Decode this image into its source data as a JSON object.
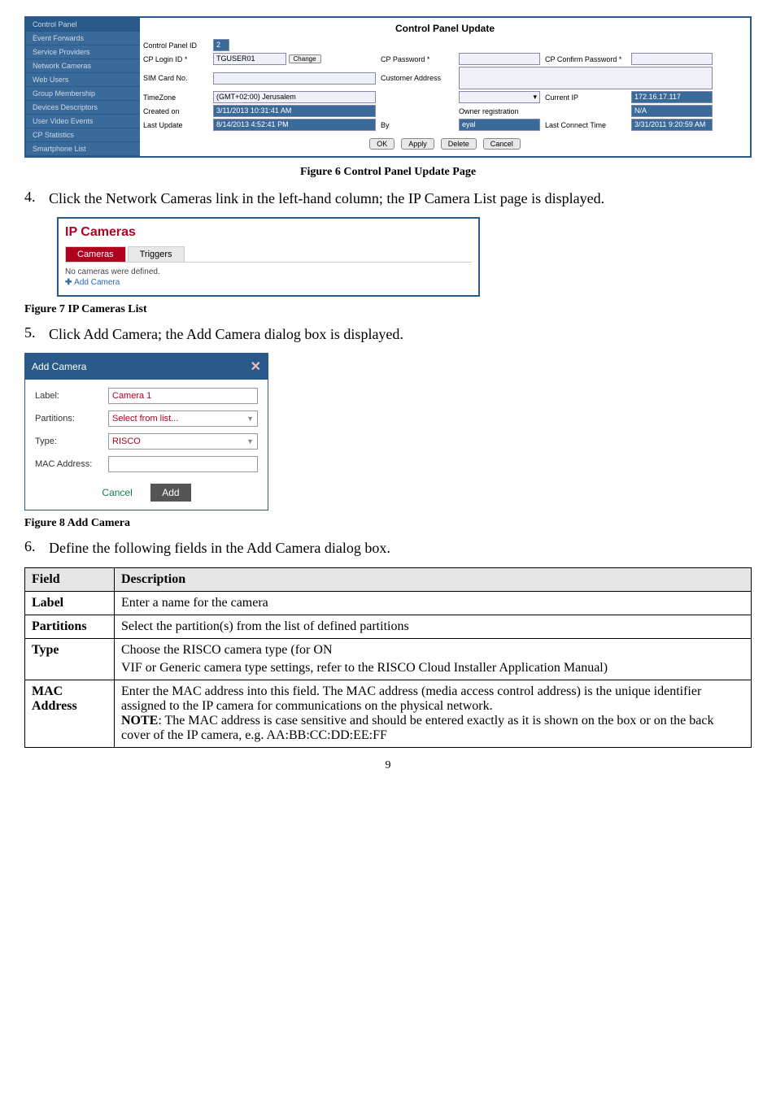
{
  "control_panel": {
    "sidebar": [
      "Control Panel",
      "Event Forwards",
      "Service Providers",
      "Network Cameras",
      "Web Users",
      "Group Membership",
      "Devices Descriptors",
      "User Video Events",
      "CP Statistics",
      "Smartphone List"
    ],
    "title": "Control Panel Update",
    "labels": {
      "cp_id": "Control Panel ID",
      "cp_id_val": "2",
      "login": "CP Login ID *",
      "login_val": "TGUSER01",
      "change": "Change",
      "pw": "CP Password *",
      "pw_confirm": "CP Confirm Password *",
      "sim": "SIM Card No.",
      "addr": "Customer Address",
      "tz": "TimeZone",
      "tz_val": "(GMT+02:00) Jerusalem",
      "cur_ip": "Current IP",
      "cur_ip_val": "172.16.17.117",
      "created": "Created on",
      "created_val": "3/11/2013 10:31:41 AM",
      "owner": "Owner registration",
      "na": "N/A",
      "last_up": "Last Update",
      "last_up_val": "8/14/2013 4:52:41 PM",
      "by": "By",
      "by_val": "eyal",
      "lct": "Last Connect Time",
      "lct_val": "3/31/2011 9:20:59 AM"
    },
    "buttons": {
      "ok": "OK",
      "apply": "Apply",
      "delete": "Delete",
      "cancel": "Cancel"
    }
  },
  "fig6_caption": "Figure 6 Control Panel Update Page",
  "step4": {
    "num": "4.",
    "text": "Click the Network Cameras link in the left-hand column; the IP Camera List page is displayed."
  },
  "ip_cameras": {
    "title": "IP Cameras",
    "tabs": {
      "cameras": "Cameras",
      "triggers": "Triggers"
    },
    "msg": "No cameras were defined.",
    "add": "Add Camera"
  },
  "fig7_caption": "Figure 7 IP Cameras List",
  "step5": {
    "num": "5.",
    "text": "Click Add Camera; the Add Camera dialog box is displayed."
  },
  "add_camera": {
    "header": "Add Camera",
    "rows": {
      "label_l": "Label:",
      "label_v": "Camera 1",
      "part_l": "Partitions:",
      "part_v": "Select from list...",
      "type_l": "Type:",
      "type_v": "RISCO",
      "mac_l": "MAC Address:"
    },
    "cancel": "Cancel",
    "add": "Add"
  },
  "fig8_caption": "Figure 8 Add Camera",
  "step6": {
    "num": "6.",
    "text": "Define the following fields in the Add Camera dialog box."
  },
  "table": {
    "headers": {
      "field": "Field",
      "desc": "Description"
    },
    "rows": [
      {
        "f": "Label",
        "d": "Enter a name for the camera"
      },
      {
        "f": "Partitions",
        "d": "Select the partition(s) from the list of defined partitions"
      },
      {
        "f": "Type",
        "d1": "Choose the RISCO camera type (for ON",
        "d2": "VIF or Generic camera type settings, refer to the RISCO Cloud Installer Application Manual)"
      },
      {
        "f": "MAC Address",
        "d1": "Enter the MAC address into this field. The MAC address (media access control address) is the unique identifier assigned to the IP camera for communications on the physical network.",
        "d2a": "NOTE",
        "d2b": ": The MAC address is case sensitive and should be entered exactly as it is shown on the box or on the back cover of the IP camera, e.g. AA:BB:CC:DD:EE:FF"
      }
    ]
  },
  "page_num": "9"
}
